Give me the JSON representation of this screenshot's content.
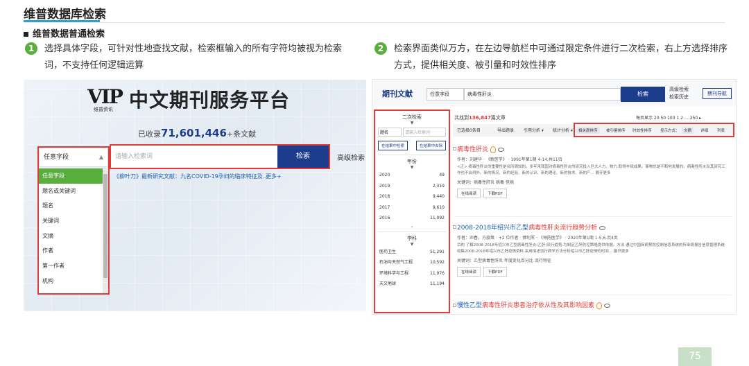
{
  "slide": {
    "title": "维普数据库检索",
    "section": "维普数据普通检索",
    "page_number": "75"
  },
  "points": [
    {
      "num": "1",
      "text": "选择具体字段，可针对性地查找文献，检索框输入的所有字符均被视为检索词，不支持任何逻辑运算"
    },
    {
      "num": "2",
      "text": "检索界面类似万方，在左边导航栏中可通过限定条件进行二次检索，右上方选择排序方式，提供相关度、被引量和时效性排序"
    }
  ],
  "left": {
    "logo_mark": "VIP",
    "logo_sub": "维普资讯",
    "logo_title": "中文期刊服务平台",
    "collected_prefix": "已收录",
    "collected_count": "71,601,446",
    "collected_suffix": "+条文献",
    "field_select": "任意字段",
    "search_placeholder": "请输入检索词",
    "search_button": "检索",
    "advanced": "高级检索",
    "dropdown_items": [
      "任意字段",
      "题名或关键词",
      "题名",
      "关键词",
      "文摘",
      "作者",
      "第一作者",
      "机构"
    ],
    "news": "《柳叶刀》最新研究文献：九名COVID-19孕妇的临床特征及...",
    "news_more": "更多+"
  },
  "right": {
    "brand": "期刊文献",
    "field_select": "任意字段",
    "query": "病毒性肝炎",
    "search_button": "检索",
    "adv1": "高级检索",
    "adv2": "检索历史",
    "nav_button": "期刊导航",
    "found_prefix": "共找到",
    "found_count": "136,847",
    "found_suffix": "篇文章",
    "perpage": "每页显示 20  50  100    1  2  …  250  ▸",
    "sidebar": {
      "title": "二次检索",
      "field_label": "题名",
      "field_placeholder": "请输入检索词",
      "btn1": "在结果中检索",
      "btn2": "在结果中去除",
      "year_title": "年份",
      "years": [
        {
          "k": "2020",
          "v": "49"
        },
        {
          "k": "2019",
          "v": "2,319"
        },
        {
          "k": "2018",
          "v": "9,440"
        },
        {
          "k": "2017",
          "v": "9,610"
        },
        {
          "k": "2016",
          "v": "11,092"
        }
      ],
      "subject_title": "学科",
      "subjects": [
        {
          "k": "医药卫生",
          "v": "51,291"
        },
        {
          "k": "石油与天然气工程",
          "v": "10,592"
        },
        {
          "k": "环境科学与工程",
          "v": "11,976"
        },
        {
          "k": "天文地球",
          "v": "11,194"
        }
      ]
    },
    "toolbar": {
      "selected": "已选择0条目",
      "export": "导出题录",
      "cite": "引用分析 ▾",
      "stats": "统计分析 ▾"
    },
    "sort": {
      "relevance": "相关度排序",
      "cited": "被引量排序",
      "time": "时效性排序",
      "display": "显示方式：",
      "view1": "文摘",
      "view2": "详细",
      "view3": "列表"
    },
    "results": [
      {
        "title_hl": "病毒性肝炎",
        "title_rest": "",
        "authors": "作者：刘建华 · 《新医学》 · 1991年第1期 4-14,共11页",
        "abstract": "<正> 病毒性肝炎的重要性是众所周知的。多年来我国对病毒性肝炎的研究投入巨大人力、物力,取得丰硕成果。事物总是不断地发展的。病毒性肝炎及其研究工作也不会例外。新的情况、新的经验、新的认识、新的理论、新的技术、新的产... 展开更多",
        "keywords": "关键词：病毒性肝炎 病毒 怪病",
        "read": "在线阅读",
        "download": "下载PDF"
      },
      {
        "title_hl": "2008-2018年绍兴市乙型",
        "title_rest": "病毒性肝炎流行趋势分析",
        "authors": "作者：邓春，方旋策 · +2 位作者 · 傅利军 · 《预防医学》 · 2020年第1期 1-5,6,共4页",
        "abstract": "目的 了解2008-2018年绍兴市乙型病毒性肝炎(乙肝)流行趋势,为制定乙肝防控策略提供依据。方法 通过中国疾病预防控制信息系统的传染病报告信息管理系统收集2008-2018年绍兴市乙肝疫情资料,采用描述流行病学方法分析绍兴市乙肝疫情的时间... 展开更多",
        "keywords": "关键词：乙型病毒性肝炎  年度变化百分比  流行特征",
        "read": "在线阅读",
        "download": "下载PDF"
      },
      {
        "title_hl": "慢性乙型",
        "title_rest": "病毒性肝炎患者治疗依从性及其影响因素",
        "authors": "",
        "abstract": "",
        "keywords": "",
        "read": "",
        "download": ""
      }
    ]
  }
}
